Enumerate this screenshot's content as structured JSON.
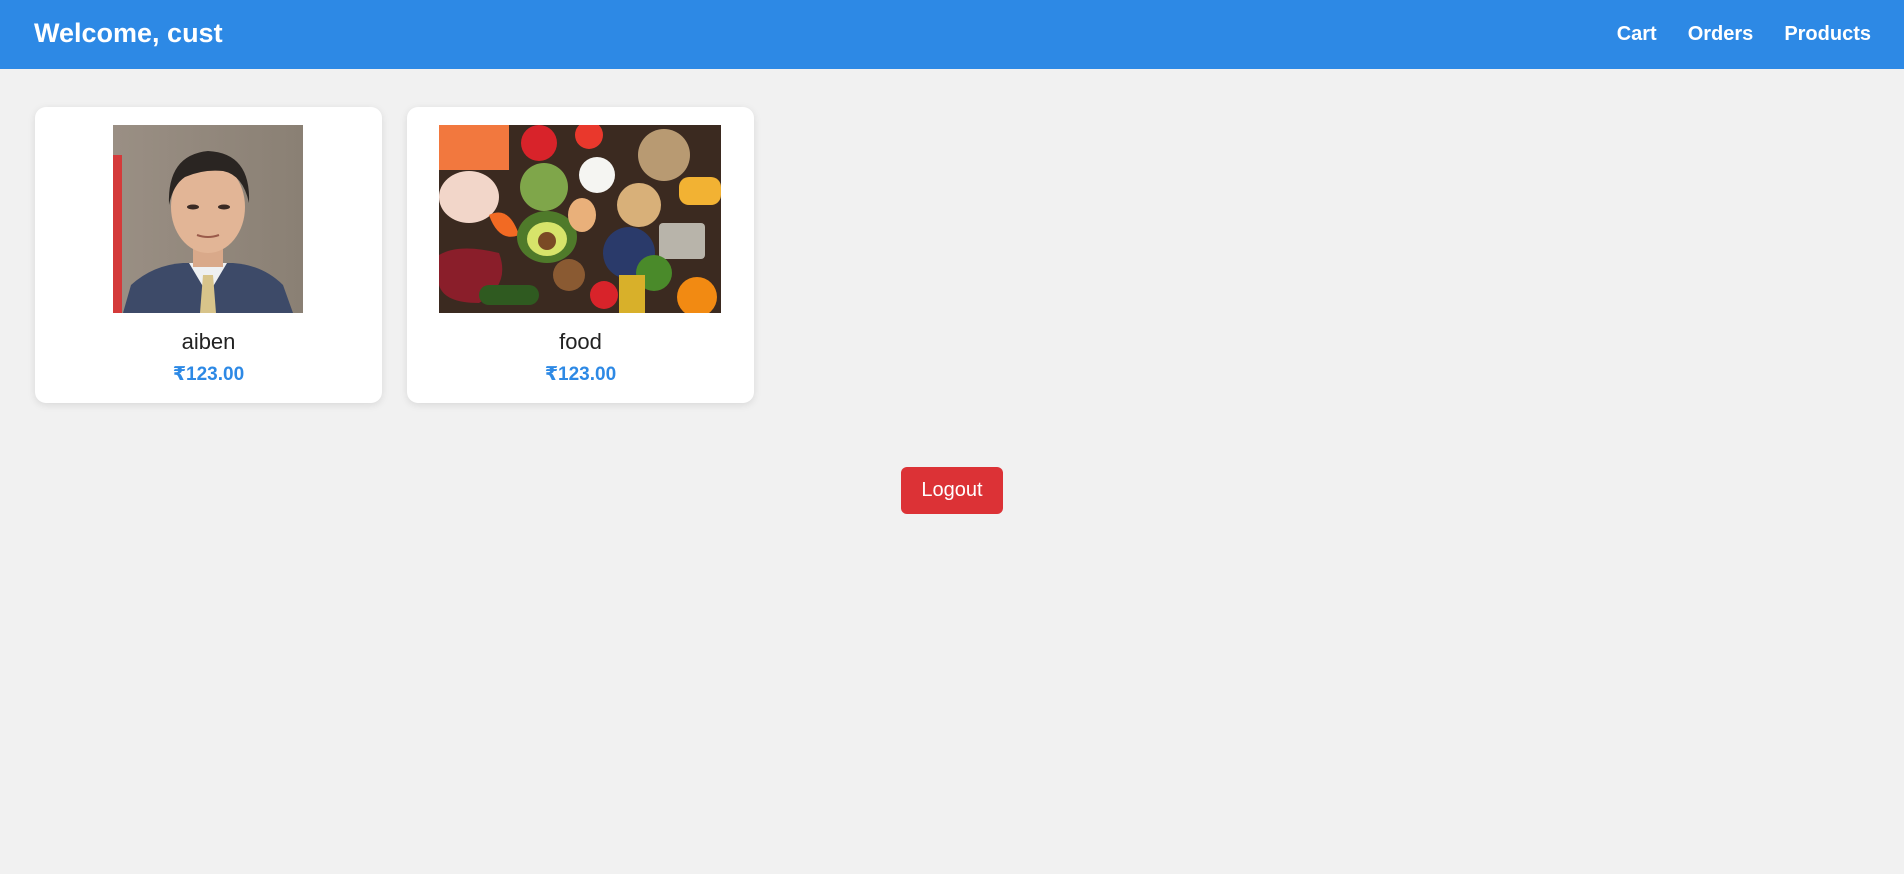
{
  "header": {
    "welcome": "Welcome, cust",
    "nav": [
      {
        "label": "Cart"
      },
      {
        "label": "Orders"
      },
      {
        "label": "Products"
      }
    ]
  },
  "products": [
    {
      "name": "aiben",
      "price": "₹123.00",
      "image": "portrait-photo"
    },
    {
      "name": "food",
      "price": "₹123.00",
      "image": "food-assortment-photo"
    }
  ],
  "logout_label": "Logout",
  "colors": {
    "header_bg": "#2d89e5",
    "price": "#2d89e5",
    "logout_bg": "#dc3236",
    "page_bg": "#f1f1f1"
  }
}
